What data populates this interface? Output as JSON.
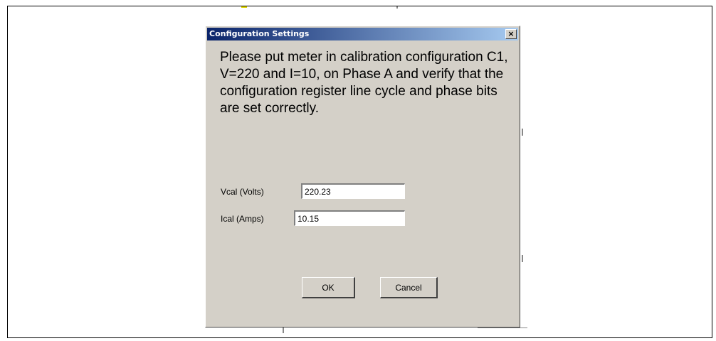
{
  "dialog": {
    "title": "Configuration Settings",
    "close_glyph": "×",
    "message": "Please put meter in calibration configuration C1, V=220 and I=10, on Phase A and verify that the configuration register line cycle and phase bits are set correctly.",
    "fields": [
      {
        "label": "Vcal (Volts)",
        "value": "220.23"
      },
      {
        "label": "Ical (Amps)",
        "value": "10.15"
      }
    ],
    "buttons": {
      "ok": "OK",
      "cancel": "Cancel"
    }
  },
  "colors": {
    "title_bar_start": "#0a246a",
    "title_bar_end": "#a6caf0",
    "dialog_face": "#d4d0c8"
  }
}
